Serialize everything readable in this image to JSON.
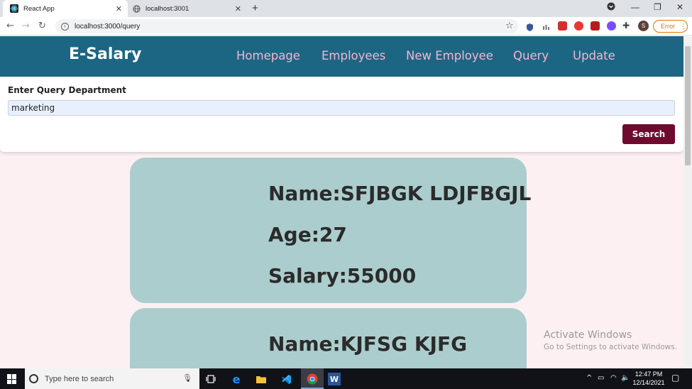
{
  "browser": {
    "tabs": [
      {
        "title": "React App",
        "active": true
      },
      {
        "title": "localhost:3001",
        "active": false
      }
    ],
    "url": "localhost:3000/query",
    "error_label": "Error",
    "profile_initial": "S"
  },
  "navbar": {
    "brand": "E-Salary",
    "links": [
      "Homepage",
      "Employees",
      "New Employee",
      "Query",
      "Update"
    ],
    "colors": {
      "bar": "#1d6683",
      "link": "#f3b5d3"
    }
  },
  "query_form": {
    "label": "Enter Query Department",
    "value": "marketing",
    "button_label": "Search",
    "button_color": "#6f0a2f"
  },
  "results": [
    {
      "name": "Name:SFJBGK LDJFBGJL",
      "age": "Age:27",
      "salary": "Salary:55000"
    },
    {
      "name": "Name:KJFSG KJFG"
    }
  ],
  "watermark": {
    "title": "Activate Windows",
    "subtitle": "Go to Settings to activate Windows."
  },
  "taskbar": {
    "search_placeholder": "Type here to search",
    "time": "12:47 PM",
    "date": "12/14/2021"
  }
}
